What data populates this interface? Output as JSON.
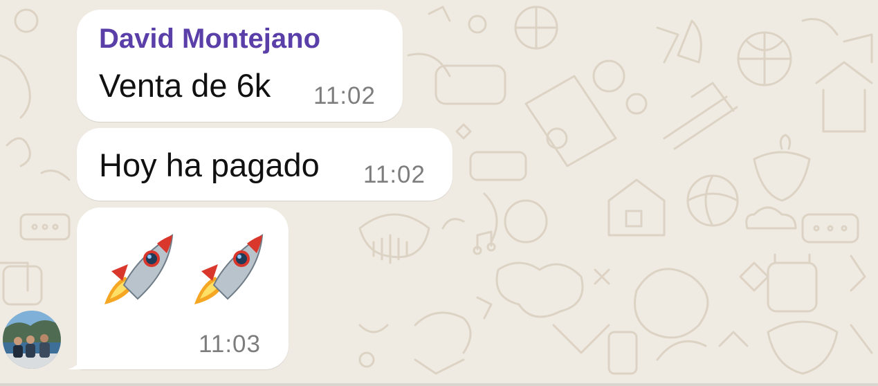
{
  "chat": {
    "sender_name": "David Montejano",
    "messages": [
      {
        "text": "Venta de 6k",
        "time": "11:02"
      },
      {
        "text": "Hoy ha pagado",
        "time": "11:02"
      },
      {
        "emoji": [
          "rocket",
          "rocket"
        ],
        "time": "11:03"
      }
    ]
  },
  "colors": {
    "background": "#efeae2",
    "bubble": "#ffffff",
    "sender_name": "#5b3fa8",
    "time": "#7d7d7d",
    "text": "#111111"
  }
}
